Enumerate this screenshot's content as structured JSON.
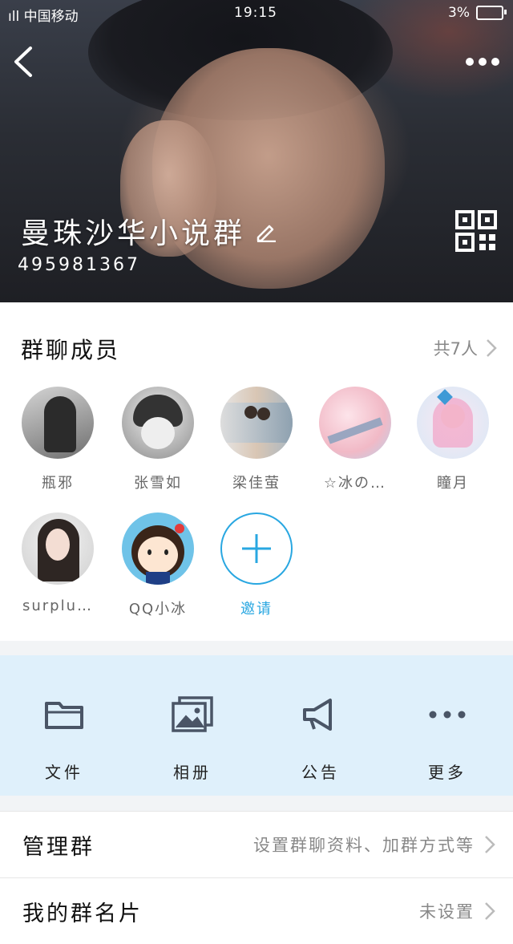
{
  "status_bar": {
    "carrier": "ıll 中国移动",
    "time": "19:15",
    "battery": "3%"
  },
  "header": {
    "group_name": "曼珠沙华小说群",
    "group_id": "495981367"
  },
  "members_section": {
    "title": "群聊成员",
    "count_label": "共7人",
    "members": [
      {
        "name": "瓶邪",
        "avatar_color": "#9a9a9a"
      },
      {
        "name": "张雪如",
        "avatar_color": "#6d6d6d"
      },
      {
        "name": "梁佳萤",
        "avatar_color": "#c9b8a8"
      },
      {
        "name": "☆冰の…",
        "avatar_color": "#f1c7cf"
      },
      {
        "name": "瞳月",
        "avatar_color": "#e8d6ea"
      },
      {
        "name": "surplu…",
        "avatar_color": "#cfcfcf"
      },
      {
        "name": "QQ小冰",
        "avatar_color": "#6fc3e8"
      }
    ],
    "invite_label": "邀请"
  },
  "actions": [
    {
      "label": "文件",
      "icon": "folder-icon"
    },
    {
      "label": "相册",
      "icon": "photo-album-icon"
    },
    {
      "label": "公告",
      "icon": "megaphone-icon"
    },
    {
      "label": "更多",
      "icon": "more-dots-icon"
    }
  ],
  "settings": [
    {
      "label": "管理群",
      "value": "设置群聊资料、加群方式等"
    },
    {
      "label": "我的群名片",
      "value": "未设置"
    }
  ],
  "colors": {
    "accent": "#29a7e1",
    "actions_bg": "#dff0fb"
  }
}
